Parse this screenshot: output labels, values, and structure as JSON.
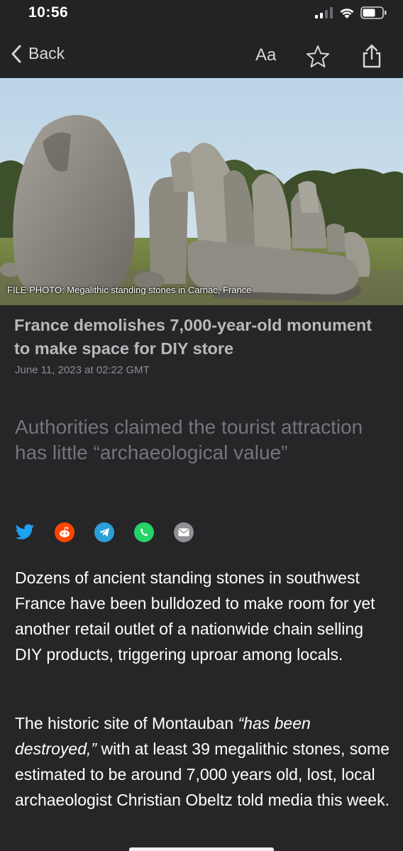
{
  "status_bar": {
    "time": "10:56"
  },
  "nav": {
    "back_label": "Back",
    "text_size_label": "Aa"
  },
  "hero": {
    "caption": "FILE PHOTO: Megalithic standing stones in Carnac, France"
  },
  "article": {
    "headline": "France demolishes 7,000-year-old monument to make space for DIY store",
    "date": "June 11, 2023 at 02:22 GMT",
    "subhead": "Authorities claimed the tourist attraction has little “archaeological value”",
    "paragraph_1": "Dozens of ancient standing stones in southwest France have been bulldozed to make room for yet another retail outlet of a nationwide chain selling DIY products, triggering uproar among locals.",
    "paragraph_2": {
      "part_1": "The historic site of Montauban ",
      "quote": "“has been destroyed,”",
      "part_2": " with at least 39 megalithic stones, some estimated to be around 7,000 years old, lost, local archaeologist Christian Obeltz told media this week."
    }
  },
  "share_buttons": [
    {
      "icon": "twitter-icon",
      "color": "#1da1f2"
    },
    {
      "icon": "reddit-icon",
      "color": "#ff4500"
    },
    {
      "icon": "telegram-icon",
      "color": "#2a9fd8"
    },
    {
      "icon": "whatsapp-icon",
      "color": "#25d366"
    },
    {
      "icon": "email-icon",
      "color": "#8f8f94"
    }
  ],
  "colors": {
    "background": "#262629",
    "headline": "#b9b9bc",
    "subhead": "#75757a"
  }
}
